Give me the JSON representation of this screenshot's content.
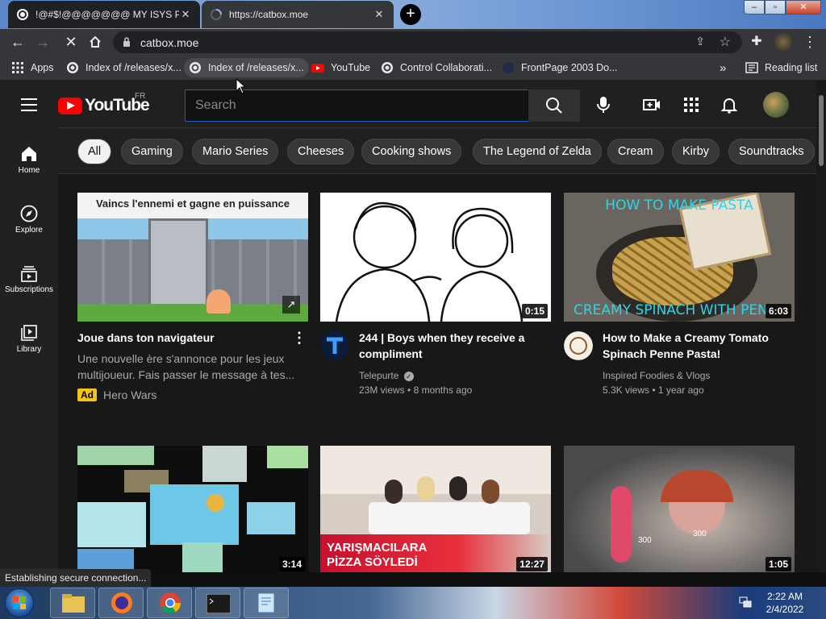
{
  "browser": {
    "tabs": [
      {
        "title": "!@#$!@@@@@@@ MY ISYS PR",
        "state": "inactive"
      },
      {
        "title": "https://catbox.moe",
        "state": "active"
      }
    ],
    "address_url": "catbox.moe",
    "bookmarks": [
      {
        "label": "Apps",
        "icon": "apps-grid-icon"
      },
      {
        "label": "Index of /releases/x...",
        "icon": "globe-icon"
      },
      {
        "label": "Index of /releases/x...",
        "icon": "globe-icon"
      },
      {
        "label": "YouTube",
        "icon": "youtube-icon"
      },
      {
        "label": "Control Collaborati...",
        "icon": "globe-icon"
      },
      {
        "label": "FrontPage 2003 Do...",
        "icon": "frontpage-icon"
      }
    ],
    "bookmarks_overflow": "»",
    "reading_list": "Reading list",
    "status_text": "Establishing secure connection..."
  },
  "youtube": {
    "logo_text": "YouTube",
    "country": "FR",
    "search_placeholder": "Search",
    "sidebar": [
      {
        "label": "Home",
        "icon": "home-icon"
      },
      {
        "label": "Explore",
        "icon": "explore-compass-icon"
      },
      {
        "label": "Subscriptions",
        "icon": "subscriptions-icon"
      },
      {
        "label": "Library",
        "icon": "library-icon"
      }
    ],
    "chips": [
      "All",
      "Gaming",
      "Mario Series",
      "Cheeses",
      "Cooking shows",
      "The Legend of Zelda",
      "Cream",
      "Kirby",
      "Soundtracks"
    ],
    "videos": [
      {
        "thumb_text": "Vaincs l'ennemi et gagne en puissance",
        "title": "Joue dans ton navigateur",
        "description": "Une nouvelle ère s'annonce pour les jeux multijoueur. Fais passer le message à tes...",
        "ad_badge": "Ad",
        "advertiser": "Hero Wars",
        "is_ad": true
      },
      {
        "title_line1": "244 | Boys when they receive a",
        "title_line2": "compliment",
        "channel": "Telepurte",
        "views": "23M views",
        "age": "8 months ago",
        "duration": "0:15",
        "verified": true
      },
      {
        "thumb_text_top": "HOW TO MAKE PASTA",
        "thumb_text_bottom": "CREAMY SPINACH WITH PEN",
        "title_line1": "How to Make a Creamy Tomato",
        "title_line2": "Spinach Penne Pasta!",
        "channel": "Inspired Foodies & Vlogs",
        "views": "5.3K views",
        "age": "1 year ago",
        "duration": "6:03"
      },
      {
        "duration": "3:14"
      },
      {
        "thumb_text_line1": "YARIŞMACILARA",
        "thumb_text_line2": "PİZZA SÖYLEDİ",
        "duration": "12:27"
      },
      {
        "duration": "1:05",
        "overlay_num1": "300",
        "overlay_num2": "300"
      }
    ],
    "bullet": "•"
  },
  "taskbar": {
    "time": "2:22 AM",
    "date": "2/4/2022",
    "apps": [
      "explorer-folder-icon",
      "firefox-icon",
      "chrome-icon",
      "cmd-icon",
      "notepad-icon"
    ]
  },
  "colors": {
    "yt_red": "#ff0000",
    "focus_blue": "#1c62b9",
    "ad_yellow": "#f0c419"
  }
}
